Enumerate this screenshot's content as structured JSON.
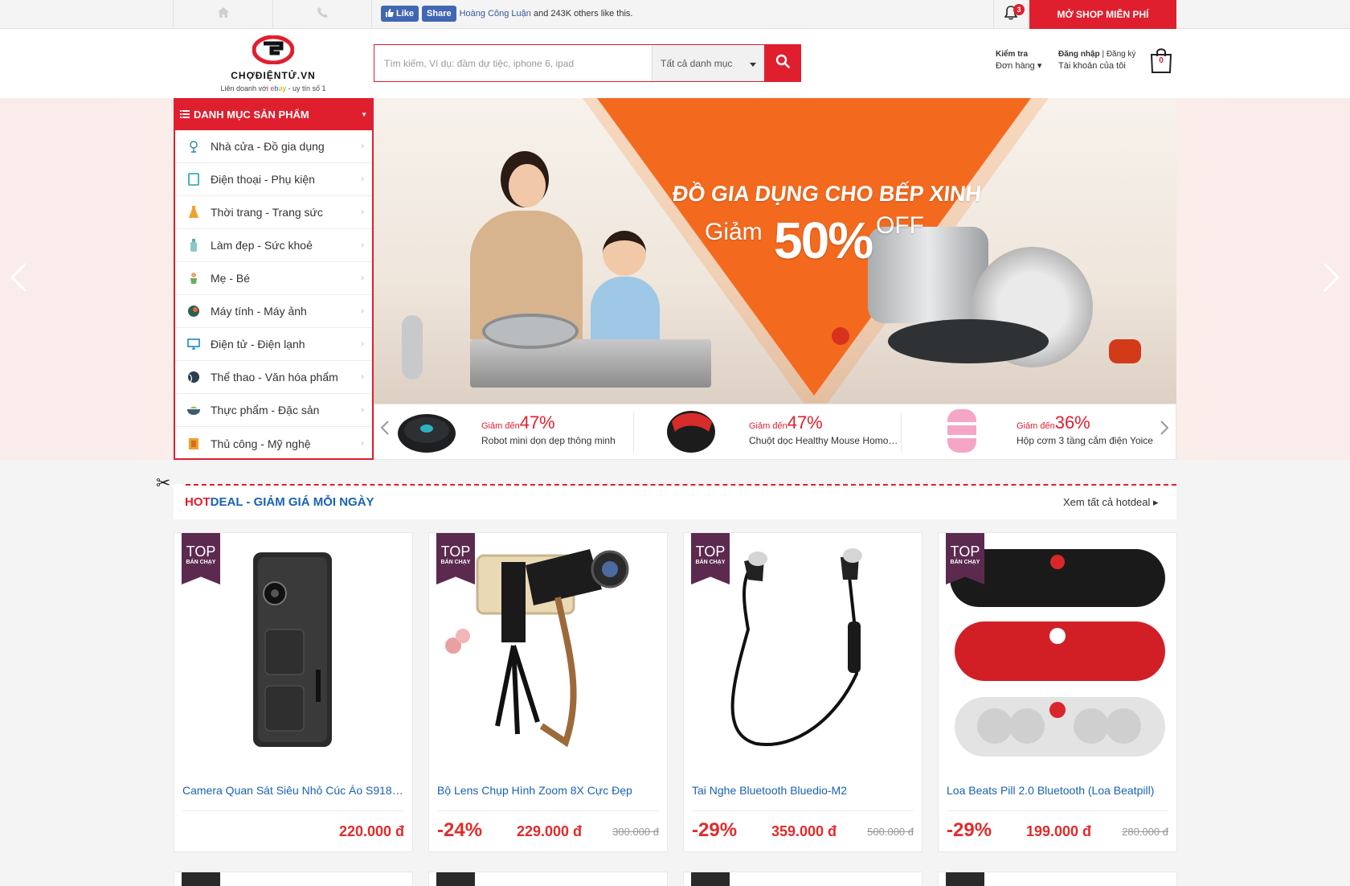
{
  "topbar": {
    "fb_like": "Like",
    "fb_share": "Share",
    "fb_friend": "Hoàng Công Luận",
    "fb_text": "and 243K others like this.",
    "notifications_count": "3",
    "open_shop": "MỞ SHOP MIỄN PHÍ"
  },
  "header": {
    "logo_text": "CHỢĐIỆNTỬ.VN",
    "logo_sub_pre": "Liên doanh với",
    "logo_ebay": [
      "e",
      "b",
      "a",
      "y"
    ],
    "logo_sub_post": "- uy tín số 1",
    "search_placeholder": "Tìm kiếm, Ví dụ: đầm dự tiệc, iphone 6, ipad",
    "search_category": "Tất cả danh mục",
    "order_line1": "Kiểm tra",
    "order_line2": "Đơn hàng",
    "login": "Đăng nhập",
    "register": "Đăng ký",
    "account": "Tài khoản của tôi",
    "cart_count": "0"
  },
  "sidebar": {
    "title": "DANH MỤC SẢN PHẨM",
    "items": [
      {
        "label": "Nhà cửa - Đồ gia dụng",
        "icon": "house-icon"
      },
      {
        "label": "Điện thoại - Phụ kiện",
        "icon": "phone-icon"
      },
      {
        "label": "Thời trang - Trang sức",
        "icon": "dress-icon"
      },
      {
        "label": "Làm đẹp - Sức khoẻ",
        "icon": "bottle-icon"
      },
      {
        "label": "Mẹ - Bé",
        "icon": "baby-icon"
      },
      {
        "label": "Máy tính - Máy ảnh",
        "icon": "camera-icon"
      },
      {
        "label": "Điện tử - Điện lạnh",
        "icon": "monitor-icon"
      },
      {
        "label": "Thể thao - Văn hóa phẩm",
        "icon": "ball-icon"
      },
      {
        "label": "Thực phẩm - Đặc sản",
        "icon": "food-icon"
      },
      {
        "label": "Thủ công - Mỹ nghệ",
        "icon": "craft-icon"
      }
    ]
  },
  "banner": {
    "headline": "ĐỒ GIA DỤNG CHO BẾP XINH",
    "giam": "Giảm",
    "percent": "50%",
    "off": "OFF"
  },
  "deals": [
    {
      "prefix": "Giảm đến",
      "percent": "47%",
      "name": "Robot mini dọn dẹp thông minh"
    },
    {
      "prefix": "Giảm đến",
      "percent": "47%",
      "name": "Chuột dọc Healthy Mouse Homoo..."
    },
    {
      "prefix": "Giảm đến",
      "percent": "36%",
      "name": "Hộp cơm 3 tầng cắm điện Yoice"
    }
  ],
  "hotdeal": {
    "title_hot": "HOT",
    "title_rest": "DEAL - GIẢM GIÁ MỖI NGÀY",
    "see_all": "Xem tất cả hotdeal"
  },
  "ribbon": {
    "top": "TOP",
    "sub": "BÁN CHẠY"
  },
  "products": [
    {
      "name": "Camera Quan Sát Siêu Nhỏ Cúc Áo S918 H...",
      "discount": "",
      "price": "220.000 đ",
      "old_price": ""
    },
    {
      "name": "Bộ Lens Chụp Hình Zoom 8X Cực Đẹp",
      "discount": "-24%",
      "price": "229.000 đ",
      "old_price": "300.000 đ"
    },
    {
      "name": "Tai Nghe Bluetooth Bluedio-M2",
      "discount": "-29%",
      "price": "359.000 đ",
      "old_price": "500.000 đ"
    },
    {
      "name": "Loa Beats Pill 2.0 Bluetooth (Loa Beatpill)",
      "discount": "-29%",
      "price": "199.000 đ",
      "old_price": "280.000 đ"
    }
  ],
  "colors": {
    "brand_red": "#e01f2e",
    "link_blue": "#1a62b0",
    "banner_orange": "#f36a1e"
  }
}
